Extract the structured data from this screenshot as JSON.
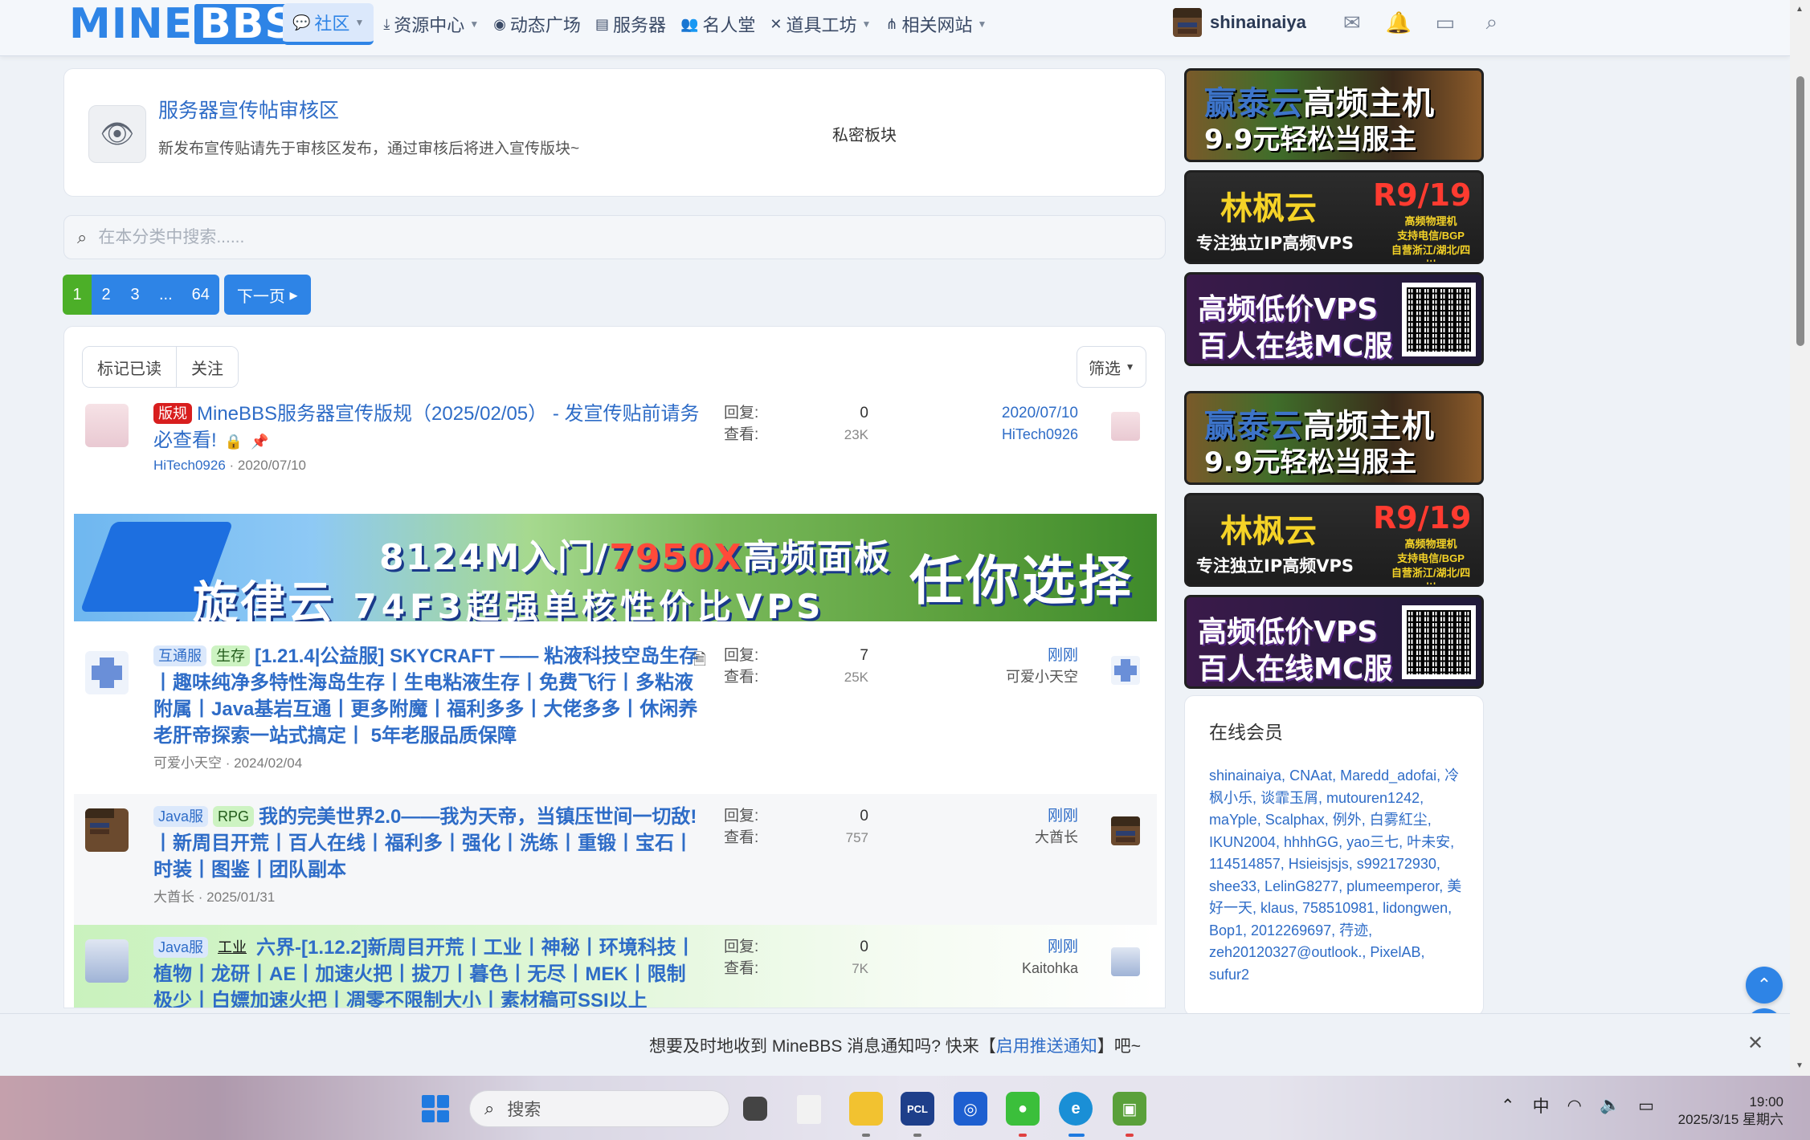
{
  "nav": {
    "logo_main": "MINE",
    "logo_box": "BBS",
    "items": [
      {
        "label": "社区",
        "icon": "chat-icon",
        "caret": true
      },
      {
        "label": "资源中心",
        "icon": "download-icon",
        "caret": true
      },
      {
        "label": "动态广场",
        "icon": "broadcast-icon",
        "caret": false
      },
      {
        "label": "服务器",
        "icon": "server-icon",
        "caret": false
      },
      {
        "label": "名人堂",
        "icon": "users-icon",
        "caret": false
      },
      {
        "label": "道具工坊",
        "icon": "tools-icon",
        "caret": true
      },
      {
        "label": "相关网站",
        "icon": "sitemap-icon",
        "caret": true
      }
    ],
    "username": "shinainaiya",
    "icons": [
      "mail-icon",
      "bell-icon",
      "wallet-icon",
      "search-icon"
    ]
  },
  "review": {
    "title": "服务器宣传帖审核区",
    "desc": "新发布宣传贴请先于审核区发布，通过审核后将进入宣传版块~",
    "private": "私密板块"
  },
  "search": {
    "placeholder": "在本分类中搜索......"
  },
  "pager": {
    "pages": [
      "1",
      "2",
      "3",
      "...",
      "64"
    ],
    "next": "下一页"
  },
  "list": {
    "mark_read": "标记已读",
    "follow": "关注",
    "filter": "筛选",
    "reply_label": "回复:",
    "view_label": "查看:",
    "threads": [
      {
        "tags": [
          "版规"
        ],
        "title": "MineBBS服务器宣传版规（2025/02/05） - 发宣传贴前请务必查看!",
        "author": "HiTech0926",
        "date": "2020/07/10",
        "replies": "0",
        "views": "23K",
        "last_date": "2020/07/10",
        "last_user": "HiTech0926"
      },
      {
        "tags": [
          "互通服",
          "生存"
        ],
        "title": "[1.21.4|公益服] SKYCRAFT —— 粘液科技空岛生存丨趣味纯净多特性海岛生存丨生电粘液生存丨免费飞行丨多粘液附属丨Java基岩互通丨更多附魔丨福利多多丨大佬多多丨休闲养老肝帝探索一站式搞定丨 5年老服品质保障",
        "author": "可爱小天空",
        "date": "2024/02/04",
        "replies": "7",
        "views": "25K",
        "last_date": "刚刚",
        "last_user": "可爱小天空"
      },
      {
        "tags": [
          "Java服",
          "RPG"
        ],
        "title": "我的完美世界2.0——我为天帝，当镇压世间一切敌!丨新周目开荒丨百人在线丨福利多丨强化丨洗练丨重锻丨宝石丨时装丨图鉴丨团队副本",
        "author": "大酋长",
        "date": "2025/01/31",
        "replies": "0",
        "views": "757",
        "last_date": "刚刚",
        "last_user": "大酋长"
      },
      {
        "tags": [
          "Java服",
          "工业"
        ],
        "title": "六界-[1.12.2]新周目开荒丨工业丨神秘丨环境科技丨植物丨龙研丨AE丨加速火把丨拔刀丨暮色丨无尽丨MEK丨限制极少丨白嫖加速火把丨凋零不限制大小丨素材稿可SSI以上",
        "author": "Kaitohka",
        "date": "",
        "replies": "0",
        "views": "7K",
        "last_date": "刚刚",
        "last_user": "Kaitohka"
      }
    ]
  },
  "banner": {
    "top_a": "8124M入门/",
    "top_b": "7950X",
    "top_c": "高频面板",
    "brand": "旋律云",
    "bottom": "74F3超强单核性价比VPS",
    "right": "任你选择"
  },
  "ads": {
    "a_l1_hi": "赢泰云",
    "a_l1": "高频主机",
    "a_l2": "9.9元轻松当服主",
    "b_l1": "林枫云",
    "b_l2": "专注独立IP高频VPS",
    "b_r1": "R9/19",
    "b_r2": "高频物理机\n支持电信/BGP\n自营浙江/湖北/四川",
    "c_l1": "高频低价VPS",
    "c_l2": "百人在线MC服"
  },
  "online": {
    "title": "在线会员",
    "members": "shinainaiya, CNAat, Maredd_adofai, 冷枫小乐, 谈霏玉屑, mutouren1242, maYple, Scalphax, 例外, 白雾紅尘, IKUN2004, hhhhGG, yao三七, 叶未安, 114514857, Hsieisjsjs, s992172930, shee33, LelinG8277, plumeemperor, 美好一天, klaus, 758510981, lidongwen, Bop1, 2012269697, 荇迹, zeh20120327@outlook., PixelAB, sufur2"
  },
  "notify": {
    "pre": "想要及时地收到 MineBBS 消息通知吗? 快来【",
    "link": "启用推送通知",
    "post": "】吧~"
  },
  "taskbar": {
    "search": "搜索",
    "ime": "中",
    "time": "19:00",
    "date": "2025/3/15 星期六"
  }
}
